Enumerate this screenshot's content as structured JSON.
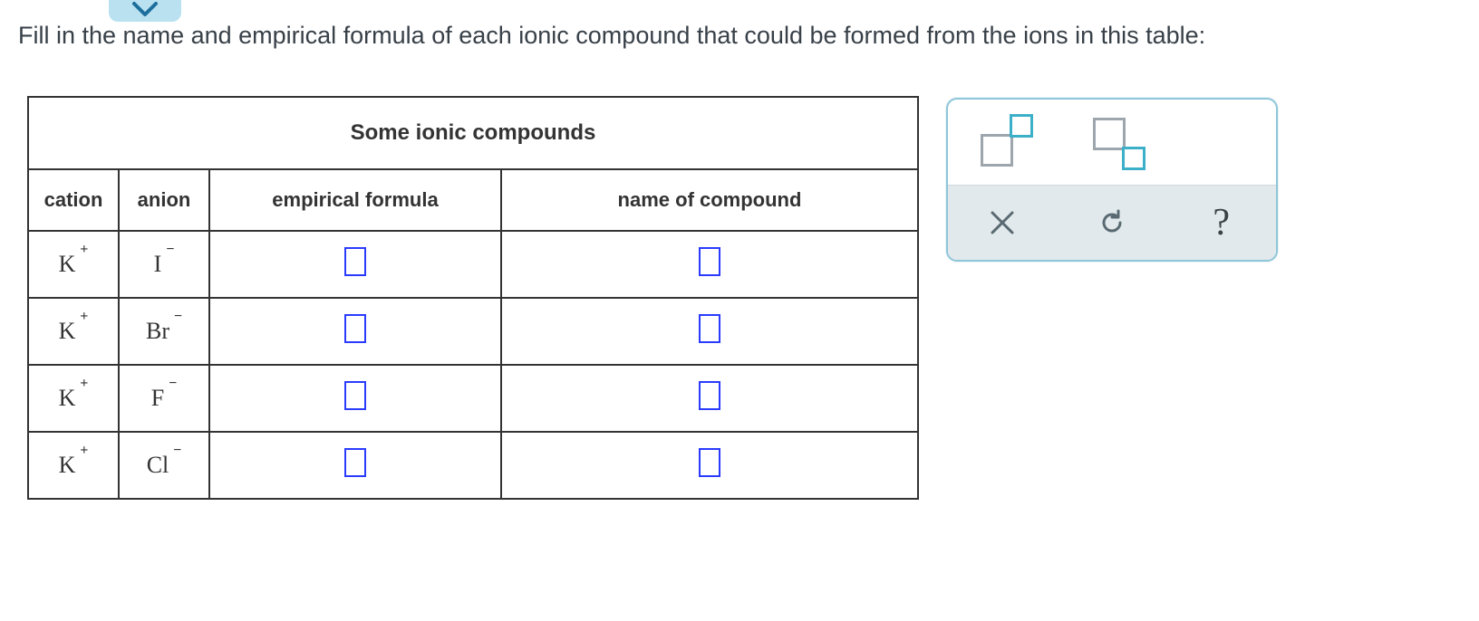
{
  "prompt": "Fill in the name and empirical formula of each ionic compound that could be formed from the ions in this table:",
  "table": {
    "title": "Some ionic compounds",
    "headers": {
      "cation": "cation",
      "anion": "anion",
      "formula": "empirical formula",
      "name": "name of compound"
    },
    "rows": [
      {
        "cation_sym": "K",
        "cation_charge": "+",
        "anion_sym": "I",
        "anion_charge": "−",
        "formula": "",
        "name": ""
      },
      {
        "cation_sym": "K",
        "cation_charge": "+",
        "anion_sym": "Br",
        "anion_charge": "−",
        "formula": "",
        "name": ""
      },
      {
        "cation_sym": "K",
        "cation_charge": "+",
        "anion_sym": "F",
        "anion_charge": "−",
        "formula": "",
        "name": ""
      },
      {
        "cation_sym": "K",
        "cation_charge": "+",
        "anion_sym": "Cl",
        "anion_charge": "−",
        "formula": "",
        "name": ""
      }
    ]
  },
  "toolbox": {
    "superscript_tool": "superscript",
    "subscript_tool": "subscript",
    "clear": "clear",
    "reset": "reset",
    "help": "?"
  }
}
